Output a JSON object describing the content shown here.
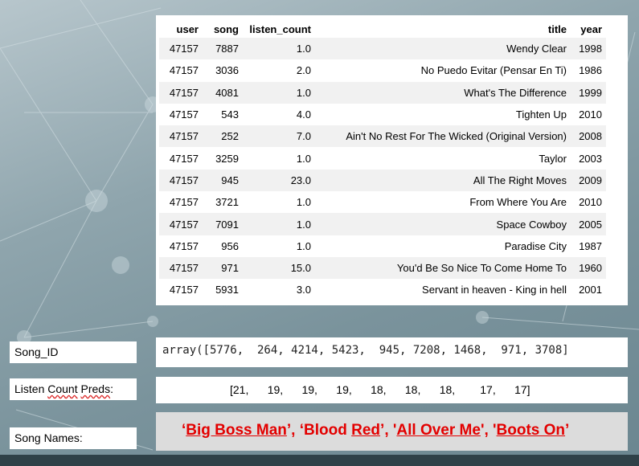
{
  "table": {
    "headers": [
      "user",
      "song",
      "listen_count",
      "title",
      "year"
    ],
    "rows": [
      [
        "47157",
        "7887",
        "1.0",
        "Wendy Clear",
        "1998"
      ],
      [
        "47157",
        "3036",
        "2.0",
        "No Puedo Evitar (Pensar En Ti)",
        "1986"
      ],
      [
        "47157",
        "4081",
        "1.0",
        "What's The Difference",
        "1999"
      ],
      [
        "47157",
        "543",
        "4.0",
        "Tighten Up",
        "2010"
      ],
      [
        "47157",
        "252",
        "7.0",
        "Ain't No Rest For The Wicked (Original Version)",
        "2008"
      ],
      [
        "47157",
        "3259",
        "1.0",
        "Taylor",
        "2003"
      ],
      [
        "47157",
        "945",
        "23.0",
        "All The Right Moves",
        "2009"
      ],
      [
        "47157",
        "3721",
        "1.0",
        "From Where You Are",
        "2010"
      ],
      [
        "47157",
        "7091",
        "1.0",
        "Space Cowboy",
        "2005"
      ],
      [
        "47157",
        "956",
        "1.0",
        "Paradise City",
        "1987"
      ],
      [
        "47157",
        "971",
        "15.0",
        "You'd Be So Nice To Come Home To",
        "1960"
      ],
      [
        "47157",
        "5931",
        "3.0",
        "Servant in heaven - King in hell",
        "2001"
      ]
    ]
  },
  "labels": {
    "song_id": "Song_ID",
    "listen_count_preds_a": "Listen ",
    "listen_count_preds_b": "Count",
    "listen_count_preds_c": " ",
    "listen_count_preds_d": "Preds",
    "listen_count_preds_e": ":",
    "song_names": "Song Names:"
  },
  "array_output": "array([5776,  264, 4214, 5423,  945, 7208, 1468,  971, 3708]",
  "preds_output": "[21,      19,      19,      19,      18,      18,      18,        17,      17]",
  "song_names": {
    "q1": "‘",
    "w1": "Big Boss Man",
    "s1": "’, ‘",
    "w2a": "Blood",
    "w2b": " ",
    "w2c": "Red",
    "s2": "’, '",
    "w3": "All Over Me",
    "s3": "', '",
    "w4": "Boots On",
    "s4": "’"
  },
  "colors": {
    "names_text": "#e30000",
    "names_bg": "#dcdcdc",
    "panel_bg": "#ffffff",
    "row_stripe": "#f1f1f1"
  }
}
